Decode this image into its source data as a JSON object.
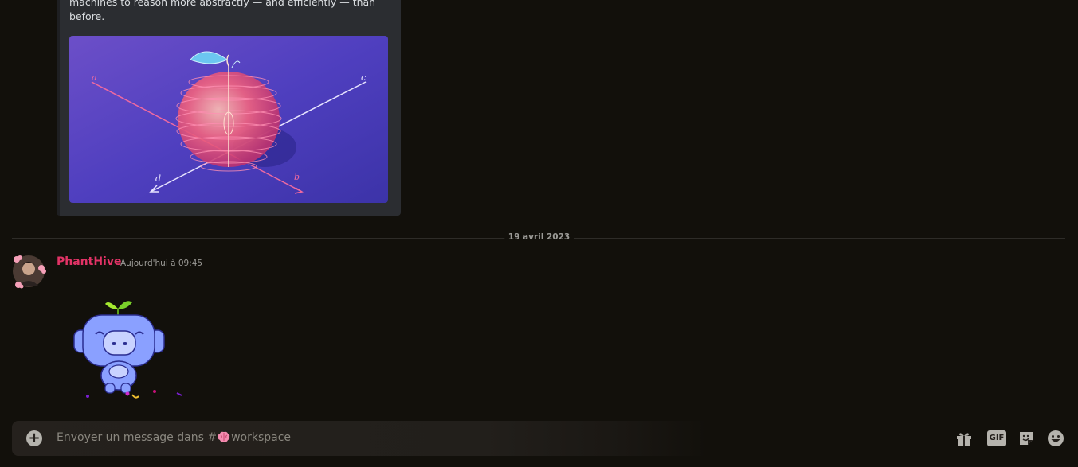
{
  "embed": {
    "description": "machines to reason more abstractly — and efficiently — than\nbefore.",
    "image_axis_labels": [
      "a",
      "c",
      "d",
      "b"
    ]
  },
  "divider": {
    "date": "19 avril 2023"
  },
  "message": {
    "author": "PhantHive",
    "timestamp": "Aujourd'hui à 09:45",
    "author_color": "#e23366"
  },
  "composer": {
    "placeholder_prefix": "Envoyer un message dans #",
    "channel_name": "workspace",
    "channel_icon": "brain-icon",
    "gif_label": "GIF"
  },
  "colors": {
    "background": "#12100b",
    "embed_bg": "#2b2d31",
    "icon": "#b5b3ad"
  }
}
